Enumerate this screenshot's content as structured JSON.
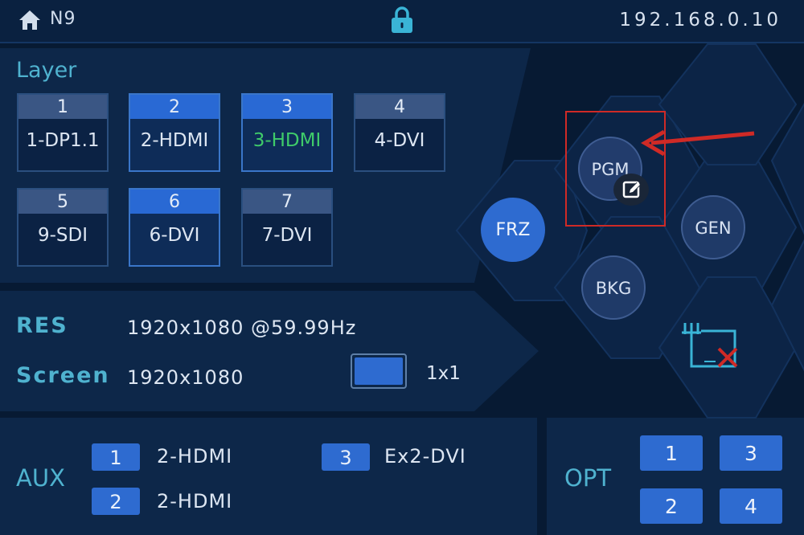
{
  "header": {
    "device_name": "N9",
    "ip": "192.168.0.10"
  },
  "layer": {
    "label": "Layer",
    "tiles": [
      {
        "num": "1",
        "source": "1-DP1.1"
      },
      {
        "num": "2",
        "source": "2-HDMI"
      },
      {
        "num": "3",
        "source": "3-HDMI"
      },
      {
        "num": "4",
        "source": "4-DVI"
      },
      {
        "num": "5",
        "source": "9-SDI"
      },
      {
        "num": "6",
        "source": "6-DVI"
      },
      {
        "num": "7",
        "source": "7-DVI"
      }
    ]
  },
  "output": {
    "res_label": "RES",
    "res_value": "1920x1080 @59.99Hz",
    "screen_label": "Screen",
    "screen_value": "1920x1080",
    "screen_mode": "1x1"
  },
  "buttons": {
    "frz": "FRZ",
    "pgm": "PGM",
    "gen": "GEN",
    "bkg": "BKG"
  },
  "aux": {
    "label": "AUX",
    "items": [
      {
        "num": "1",
        "source": "2-HDMI"
      },
      {
        "num": "2",
        "source": "2-HDMI"
      },
      {
        "num": "3",
        "source": "Ex2-DVI"
      }
    ]
  },
  "opt": {
    "label": "OPT",
    "buttons": [
      "1",
      "3",
      "2",
      "4"
    ]
  },
  "colors": {
    "accent": "#2e6bd0",
    "highlight": "#cf2a26",
    "label": "#4fb2cf",
    "active_source": "#3fcb6a"
  },
  "icons": [
    "home-icon",
    "lock-icon",
    "edit-icon",
    "screen-off-icon",
    "arrow-icon"
  ]
}
